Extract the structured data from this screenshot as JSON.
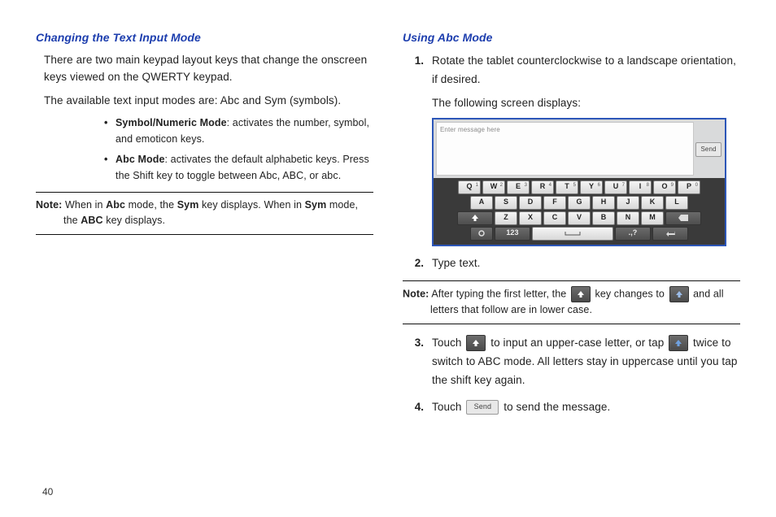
{
  "page_number": "40",
  "left": {
    "heading": "Changing the Text Input Mode",
    "p1": "There are two main keypad layout keys that change the onscreen keys viewed on the QWERTY keypad.",
    "p2": "The available text input modes are: Abc and Sym (symbols).",
    "bullet1_prefix": "Symbol/Numeric Mode",
    "bullet1_rest": ": activates the number, symbol, and emoticon keys.",
    "bullet2_prefix": "Abc Mode",
    "bullet2_rest": ": activates the default alphabetic keys. Press the Shift key to toggle between Abc, ABC, or abc.",
    "note_label": "Note:",
    "note_t1": " When in ",
    "note_b1": "Abc",
    "note_t2": " mode, the ",
    "note_b2": "Sym",
    "note_t3": " key displays. When in ",
    "note_b3": "Sym",
    "note_t4": " mode, the ",
    "note_b4": "ABC",
    "note_t5": " key displays."
  },
  "right": {
    "heading": "Using Abc Mode",
    "step1": "Rotate the tablet counterclockwise to a landscape orientation, if desired.",
    "step1b": "The following screen displays:",
    "kbd_placeholder": "Enter message here",
    "kbd_send": "Send",
    "row1": [
      {
        "k": "Q",
        "s": "1"
      },
      {
        "k": "W",
        "s": "2"
      },
      {
        "k": "E",
        "s": "3"
      },
      {
        "k": "R",
        "s": "4"
      },
      {
        "k": "T",
        "s": "5"
      },
      {
        "k": "Y",
        "s": "6"
      },
      {
        "k": "U",
        "s": "7"
      },
      {
        "k": "I",
        "s": "8"
      },
      {
        "k": "O",
        "s": "9"
      },
      {
        "k": "P",
        "s": "0"
      }
    ],
    "row2": [
      "A",
      "S",
      "D",
      "F",
      "G",
      "H",
      "J",
      "K",
      "L"
    ],
    "row3": [
      "Z",
      "X",
      "C",
      "V",
      "B",
      "N",
      "M"
    ],
    "row4_123": "123",
    "row4_dotq": ".,?",
    "step2": "Type text.",
    "note_label": "Note:",
    "note_t1": " After typing the first letter, the ",
    "note_t2": " key changes to ",
    "note_t3": " and all letters that follow are in lower case.",
    "step3a": "Touch ",
    "step3b": " to input an upper-case letter, or tap ",
    "step3c": " twice to switch to ABC mode. All letters stay in uppercase until you tap the shift key again.",
    "step4a": "Touch ",
    "step4b": " to send the message.",
    "send_label": "Send"
  }
}
